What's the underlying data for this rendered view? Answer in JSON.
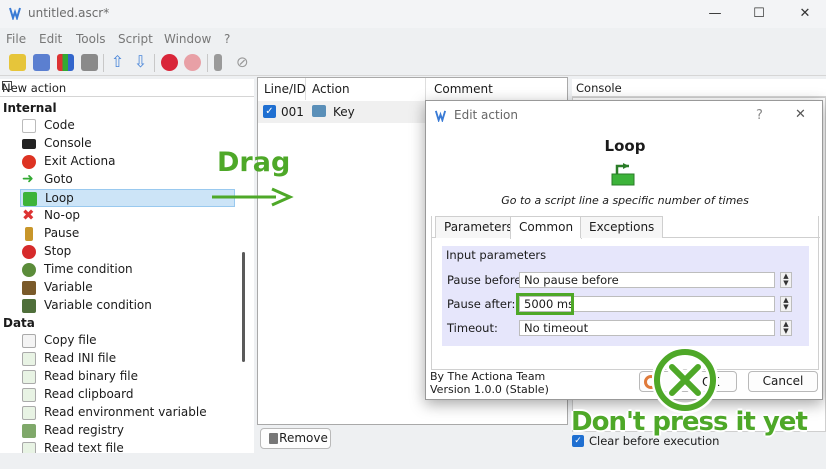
{
  "window": {
    "title": "untitled.ascr*",
    "minimize": "—",
    "maximize": "☐",
    "close": "✕"
  },
  "menu": [
    "File",
    "Edit",
    "Tools",
    "Script",
    "Window",
    "?"
  ],
  "new_action_panel": {
    "title": "New action",
    "categories": [
      {
        "name": "Internal",
        "items": [
          "Code",
          "Console",
          "Exit Actiona",
          "Goto",
          "Loop",
          "No-op",
          "Pause",
          "Stop",
          "Time condition",
          "Variable",
          "Variable condition"
        ]
      },
      {
        "name": "Data",
        "items": [
          "Copy file",
          "Read INI file",
          "Read binary file",
          "Read clipboard",
          "Read environment variable",
          "Read registry",
          "Read text file"
        ]
      }
    ]
  },
  "script_list": {
    "columns": [
      "Line/ID",
      "Action",
      "Comment"
    ],
    "rows": [
      {
        "line": "001",
        "action": "Key",
        "comment": ""
      }
    ],
    "remove_button": "Remove"
  },
  "console_panel": {
    "title": "Console",
    "clear_label": "Clear before execution"
  },
  "dialog": {
    "title": "Edit action",
    "help": "?",
    "close": "✕",
    "action_name": "Loop",
    "action_description": "Go to a script line a specific number of times",
    "tabs": [
      "Parameters",
      "Common",
      "Exceptions"
    ],
    "group_title": "Input parameters",
    "fields": [
      {
        "label": "Pause before:",
        "value": "No pause before"
      },
      {
        "label": "Pause after:",
        "value": "5000 ms"
      },
      {
        "label": "Timeout:",
        "value": "No timeout"
      }
    ],
    "footer_line1": "By The Actiona Team",
    "footer_line2": "Version 1.0.0 (Stable)",
    "ok": "OK",
    "cancel": "Cancel"
  },
  "annotations": {
    "drag": "Drag",
    "dont_press": "Don't press it yet"
  },
  "colors": {
    "accent_green": "#4ea828",
    "selection": "#cce4f7",
    "dialog_group": "#e6e6fb"
  }
}
